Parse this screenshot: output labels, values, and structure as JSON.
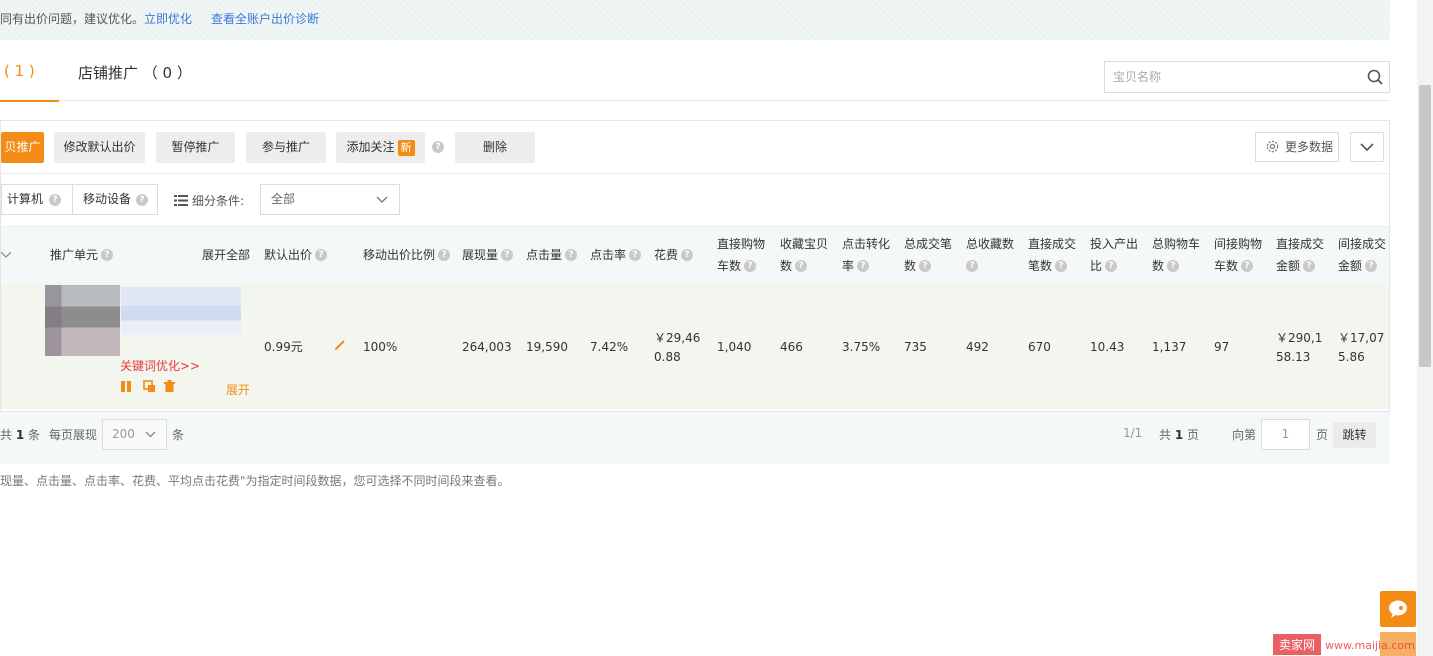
{
  "notice": {
    "message": "同有出价问题，建议优化。",
    "link_optimize": "立即优化",
    "link_diagnose": "查看全账户出价诊断"
  },
  "tabs": {
    "item_tab": "( 1 )",
    "store_tab": "店铺推广 （ 0 ）"
  },
  "search": {
    "placeholder": "宝贝名称"
  },
  "toolbar": {
    "promote_item": "贝推广",
    "edit_default_bid": "修改默认出价",
    "pause": "暂停推广",
    "join": "参与推广",
    "add_follow": "添加关注",
    "new_badge": "新",
    "delete": "删除",
    "more_data": "更多数据"
  },
  "filters": {
    "computer": "计算机",
    "mobile": "移动设备",
    "segment_label": "细分条件:",
    "segment_value": "全部"
  },
  "table": {
    "headers": {
      "unit": "推广单元",
      "expand_all": "展开全部",
      "default_bid": "默认出价",
      "mobile_ratio": "移动出价比例",
      "impressions": "展现量",
      "clicks": "点击量",
      "ctr": "点击率",
      "cost": "花费",
      "direct_cart_1": "直接购物",
      "direct_cart_2": "车数",
      "fav_item_1": "收藏宝贝",
      "fav_item_2": "数",
      "cvr_1": "点击转化",
      "cvr_2": "率",
      "total_orders_1": "总成交笔",
      "total_orders_2": "数",
      "total_fav_1": "总收藏数",
      "direct_orders_1": "直接成交",
      "direct_orders_2": "笔数",
      "roi_1": "投入产出",
      "roi_2": "比",
      "total_cart_1": "总购物车",
      "total_cart_2": "数",
      "indirect_cart_1": "间接购物",
      "indirect_cart_2": "车数",
      "direct_amount_1": "直接成交",
      "direct_amount_2": "金额",
      "indirect_amount_1": "间接成交",
      "indirect_amount_2": "金额"
    },
    "row": {
      "keyword_link": "关键词优化>>",
      "expand": "展开",
      "default_bid": "0.99元",
      "mobile_ratio": "100%",
      "impressions": "264,003",
      "clicks": "19,590",
      "ctr": "7.42%",
      "cost_1": "￥29,46",
      "cost_2": "0.88",
      "direct_cart": "1,040",
      "fav_item": "466",
      "cvr": "3.75%",
      "total_orders": "735",
      "total_fav": "492",
      "direct_orders": "670",
      "roi": "10.43",
      "total_cart": "1,137",
      "indirect_cart": "97",
      "direct_amount_1": "￥290,1",
      "direct_amount_2": "58.13",
      "indirect_amount_1": "￥17,07",
      "indirect_amount_2": "5.86"
    }
  },
  "pager": {
    "total_prefix": "共",
    "total_count": "1",
    "total_suffix": "条",
    "per_page_label": "每页展现",
    "per_page_value": "200",
    "per_page_unit": "条",
    "page_indicator": "1/1",
    "pages_prefix": "共",
    "pages_count": "1",
    "pages_suffix": "页",
    "goto_label": "向第",
    "goto_value": "1",
    "goto_unit": "页",
    "jump": "跳转"
  },
  "footnote": "现量、点击量、点击率、花费、平均点击花费\"为指定时间段数据，您可选择不同时间段来查看。",
  "watermark": {
    "logo": "卖家网",
    "site": "www.maijia.com"
  },
  "colors": {
    "accent": "#f48b14",
    "link": "#3a7bd5",
    "danger": "#e4393c"
  }
}
